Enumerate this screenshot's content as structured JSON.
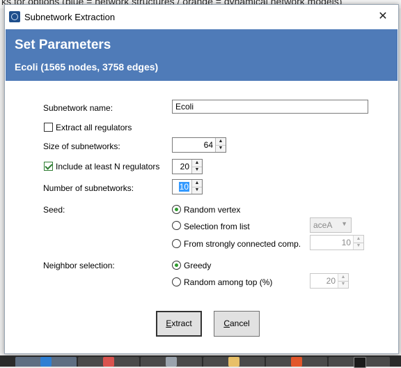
{
  "background_text": "ks for options (blue = network structures / orange = dynamical network models)",
  "window": {
    "title": "Subnetwork Extraction",
    "close_glyph": "✕"
  },
  "header": {
    "title": "Set Parameters",
    "subtitle": "Ecoli (1565 nodes, 3758 edges)"
  },
  "form": {
    "name_label": "Subnetwork name:",
    "name_value": "Ecoli",
    "extract_all_label": "Extract all regulators",
    "extract_all_checked": false,
    "size_label": "Size of subnetworks:",
    "size_value": "64",
    "include_label": "Include at least N regulators",
    "include_checked": true,
    "include_value": "20",
    "number_label": "Number of subnetworks:",
    "number_value": "10",
    "seed_label": "Seed:",
    "seed_options": [
      "Random vertex",
      "Selection from list",
      "From strongly connected comp."
    ],
    "seed_selected": 0,
    "seed_list_value": "aceA",
    "seed_scc_value": "10",
    "neighbor_label": "Neighbor selection:",
    "neighbor_options": [
      "Greedy",
      "Random among top (%)"
    ],
    "neighbor_selected": 0,
    "neighbor_top_value": "20"
  },
  "buttons": {
    "extract_mnemonic": "E",
    "extract_rest": "xtract",
    "cancel_mnemonic": "C",
    "cancel_rest": "ancel"
  },
  "icons": [
    "app-icon",
    "close-icon",
    "spin-up-icon",
    "spin-down-icon",
    "dropdown-arrow-icon"
  ]
}
